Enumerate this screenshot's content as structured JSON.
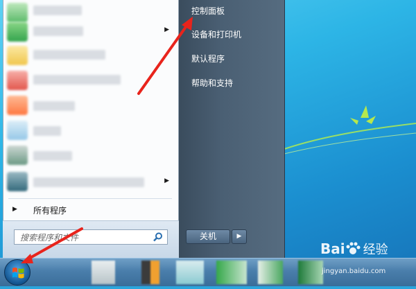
{
  "right_pane": {
    "items": [
      {
        "label": "控制面板"
      },
      {
        "label": "设备和打印机"
      },
      {
        "label": "默认程序"
      },
      {
        "label": "帮助和支持"
      }
    ]
  },
  "left_pane": {
    "all_programs_label": "所有程序",
    "search_placeholder": "搜索程序和文件",
    "program_items_count_note": ""
  },
  "power": {
    "shutdown_label": "关机"
  },
  "watermark": {
    "logo_text": "Bai",
    "logo_text2": "经验",
    "domain": "jingyan.baidu.com"
  },
  "colors": {
    "annotation_arrow": "#e8241c",
    "right_pane": "#4a5f73",
    "taskbar": "#4a7eab"
  },
  "icons": [
    "windows-logo-icon",
    "search-icon",
    "submenu-arrow-icon",
    "all-programs-arrow-icon",
    "shutdown-options-arrow-icon",
    "paw-icon"
  ]
}
